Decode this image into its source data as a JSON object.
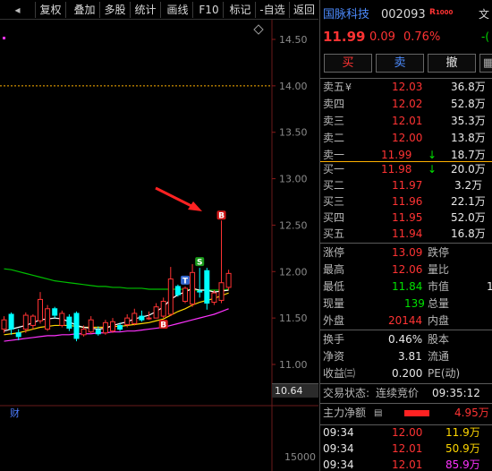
{
  "toolbar": {
    "items": [
      {
        "label": "",
        "icon": "left-arrow-icon"
      },
      {
        "label": "复权"
      },
      {
        "label": "叠加"
      },
      {
        "label": "多股"
      },
      {
        "label": "统计"
      },
      {
        "label": "画线"
      },
      {
        "label": "F10"
      },
      {
        "label": "标记"
      },
      {
        "label": "-自选"
      },
      {
        "label": "返回"
      }
    ]
  },
  "chart": {
    "price_labels": [
      "14.50",
      "14.00",
      "13.50",
      "13.00",
      "12.50",
      "12.00",
      "11.50",
      "11.00"
    ],
    "current_price": "10.64",
    "volume_label": "15000",
    "signal_b": "B",
    "signal_s": "S",
    "signal_t": "T",
    "finance_marker": "财",
    "colors": {
      "up": "#ff3333",
      "down": "#00ffff",
      "ma5": "#ffffff",
      "ma10": "#ffd700",
      "ma20": "#ff33ff",
      "ma60": "#00c000",
      "reference": "#ffb000",
      "arrow": "#ff2222"
    }
  },
  "chart_data": {
    "type": "candlestick",
    "y_axis": {
      "min": 10.64,
      "max": 14.5,
      "ticks": [
        14.5,
        14.0,
        13.5,
        13.0,
        12.5,
        12.0,
        11.5,
        11.0
      ]
    },
    "reference_line": 14.0,
    "candles": [
      {
        "o": 11.38,
        "c": 11.48,
        "h": 11.52,
        "l": 11.34
      },
      {
        "o": 11.54,
        "c": 11.38,
        "h": 11.56,
        "l": 11.32
      },
      {
        "o": 11.34,
        "c": 11.3,
        "h": 11.38,
        "l": 11.26
      },
      {
        "o": 11.38,
        "c": 11.53,
        "h": 11.56,
        "l": 11.34
      },
      {
        "o": 11.42,
        "c": 11.52,
        "h": 11.54,
        "l": 11.38
      },
      {
        "o": 11.47,
        "c": 11.7,
        "h": 11.78,
        "l": 11.44
      },
      {
        "o": 11.38,
        "c": 11.6,
        "h": 11.64,
        "l": 11.36
      },
      {
        "o": 11.6,
        "c": 11.53,
        "h": 11.62,
        "l": 11.5
      },
      {
        "o": 11.42,
        "c": 11.55,
        "h": 11.58,
        "l": 11.4
      },
      {
        "o": 11.51,
        "c": 11.39,
        "h": 11.54,
        "l": 11.36
      },
      {
        "o": 11.55,
        "c": 11.28,
        "h": 11.57,
        "l": 11.25
      },
      {
        "o": 11.32,
        "c": 11.38,
        "h": 11.42,
        "l": 11.3
      },
      {
        "o": 11.35,
        "c": 11.48,
        "h": 11.52,
        "l": 11.33
      },
      {
        "o": 11.37,
        "c": 11.33,
        "h": 11.41,
        "l": 11.31
      },
      {
        "o": 11.34,
        "c": 11.45,
        "h": 11.48,
        "l": 11.32
      },
      {
        "o": 11.36,
        "c": 11.46,
        "h": 11.5,
        "l": 11.34
      },
      {
        "o": 11.42,
        "c": 11.38,
        "h": 11.45,
        "l": 11.36
      },
      {
        "o": 11.43,
        "c": 11.5,
        "h": 11.54,
        "l": 11.4
      },
      {
        "o": 11.44,
        "c": 11.55,
        "h": 11.6,
        "l": 11.42
      },
      {
        "o": 11.52,
        "c": 11.48,
        "h": 11.58,
        "l": 11.46
      },
      {
        "o": 11.5,
        "c": 11.5,
        "h": 11.57,
        "l": 11.48
      },
      {
        "o": 11.5,
        "c": 11.62,
        "h": 11.66,
        "l": 11.5
      },
      {
        "o": 11.52,
        "c": 11.68,
        "h": 11.72,
        "l": 11.5
      },
      {
        "o": 11.54,
        "c": 11.92,
        "h": 12.05,
        "l": 11.52
      },
      {
        "o": 11.84,
        "c": 11.75,
        "h": 11.86,
        "l": 11.73
      },
      {
        "o": 11.68,
        "c": 11.82,
        "h": 11.84,
        "l": 11.66
      },
      {
        "o": 11.65,
        "c": 11.99,
        "h": 12.08,
        "l": 11.62
      },
      {
        "o": 11.79,
        "c": 11.78,
        "h": 12.04,
        "l": 11.72
      },
      {
        "o": 12.01,
        "c": 11.66,
        "h": 12.04,
        "l": 11.59
      },
      {
        "o": 11.67,
        "c": 11.77,
        "h": 11.8,
        "l": 11.64
      },
      {
        "o": 11.69,
        "c": 11.88,
        "h": 12.55,
        "l": 11.66
      },
      {
        "o": 11.83,
        "c": 11.98,
        "h": 12.02,
        "l": 11.8
      }
    ],
    "ma60": [
      12.03,
      12.02,
      12.0,
      11.98,
      11.96,
      11.94,
      11.92,
      11.9,
      11.89,
      11.88,
      11.87,
      11.86,
      11.85,
      11.84,
      11.84,
      11.83,
      11.83,
      11.82,
      11.82,
      11.82,
      11.81,
      11.81,
      11.81,
      11.81,
      11.81,
      11.81,
      11.8,
      11.8,
      11.8,
      11.8,
      11.8,
      11.81
    ],
    "ma10": [
      11.32,
      11.33,
      11.34,
      11.36,
      11.38,
      11.4,
      11.41,
      11.42,
      11.42,
      11.42,
      11.41,
      11.4,
      11.4,
      11.4,
      11.4,
      11.41,
      11.41,
      11.42,
      11.43,
      11.44,
      11.45,
      11.47,
      11.49,
      11.53,
      11.57,
      11.6,
      11.64,
      11.67,
      11.69,
      11.71,
      11.74,
      11.77
    ],
    "ma5": [
      11.36,
      11.38,
      11.4,
      11.42,
      11.45,
      11.48,
      11.49,
      11.5,
      11.49,
      11.46,
      11.42,
      11.4,
      11.39,
      11.38,
      11.39,
      11.42,
      11.44,
      11.46,
      11.49,
      11.51,
      11.53,
      11.57,
      11.62,
      11.7,
      11.75,
      11.78,
      11.82,
      11.8,
      11.8,
      11.78,
      11.79,
      11.8
    ],
    "ma20": [
      11.25,
      11.26,
      11.27,
      11.28,
      11.29,
      11.3,
      11.31,
      11.31,
      11.32,
      11.32,
      11.33,
      11.33,
      11.33,
      11.34,
      11.34,
      11.35,
      11.35,
      11.36,
      11.36,
      11.37,
      11.38,
      11.39,
      11.4,
      11.42,
      11.44,
      11.46,
      11.48,
      11.5,
      11.52,
      11.54,
      11.57,
      11.6
    ],
    "signals": [
      {
        "label": "B",
        "index": 22
      },
      {
        "label": "T",
        "index": 25
      },
      {
        "label": "S",
        "index": 27
      },
      {
        "label": "B",
        "index": 30
      }
    ]
  },
  "quote": {
    "name": "国脉科技",
    "code": "002093",
    "badge": "R",
    "badge2": "1000",
    "price": "11.99",
    "change": "0.09",
    "change_pct": "0.76%",
    "corner_label": "文",
    "corner_value": "-(",
    "buy_btn": "买",
    "sell_btn": "卖",
    "cancel_btn": "撤",
    "grid_icon": "grid-icon"
  },
  "asks": [
    {
      "label": "卖五",
      "mark": "¥",
      "price": "12.03",
      "vol": "36.8万"
    },
    {
      "label": "卖四",
      "mark": "",
      "price": "12.02",
      "vol": "52.8万"
    },
    {
      "label": "卖三",
      "mark": "",
      "price": "12.01",
      "vol": "35.3万"
    },
    {
      "label": "卖二",
      "mark": "",
      "price": "12.00",
      "vol": "13.8万"
    },
    {
      "label": "卖一",
      "mark": "↓",
      "price": "11.99",
      "vol": "18.7万"
    }
  ],
  "bids": [
    {
      "label": "买一",
      "mark": "↓",
      "price": "11.98",
      "vol": "20.0万"
    },
    {
      "label": "买二",
      "mark": "",
      "price": "11.97",
      "vol": "3.2万"
    },
    {
      "label": "买三",
      "mark": "",
      "price": "11.96",
      "vol": "22.1万"
    },
    {
      "label": "买四",
      "mark": "",
      "price": "11.95",
      "vol": "52.0万"
    },
    {
      "label": "买五",
      "mark": "",
      "price": "11.94",
      "vol": "16.8万"
    }
  ],
  "stats": [
    {
      "l1": "涨停",
      "v1": "13.09",
      "l2": "跌停",
      "v2": ""
    },
    {
      "l1": "最高",
      "v1": "12.06",
      "l2": "量比",
      "v2": ""
    },
    {
      "l1": "最低",
      "v1": "11.84",
      "l2": "市值",
      "v2": "1"
    },
    {
      "l1": "现量",
      "v1": "139",
      "l2": "总量",
      "v2": ""
    },
    {
      "l1": "外盘",
      "v1": "20144",
      "l2": "内盘",
      "v2": ""
    }
  ],
  "stats2": [
    {
      "l1": "换手",
      "v1": "0.46%",
      "l2": "股本"
    },
    {
      "l1": "净资",
      "v1": "3.81",
      "l2": "流通"
    },
    {
      "l1": "收益㈢",
      "v1": "0.200",
      "l2": "PE(动)"
    }
  ],
  "status": {
    "label": "交易状态:",
    "value": "连续竞价",
    "time": "09:35:12"
  },
  "flow": {
    "label": "主力净额",
    "value": "4.95万"
  },
  "ticks": [
    {
      "time": "09:34",
      "price": "12.00",
      "vol": "11.9万"
    },
    {
      "time": "09:34",
      "price": "12.01",
      "vol": "50.9万"
    },
    {
      "time": "09:34",
      "price": "12.01",
      "vol": "85.9万"
    }
  ]
}
